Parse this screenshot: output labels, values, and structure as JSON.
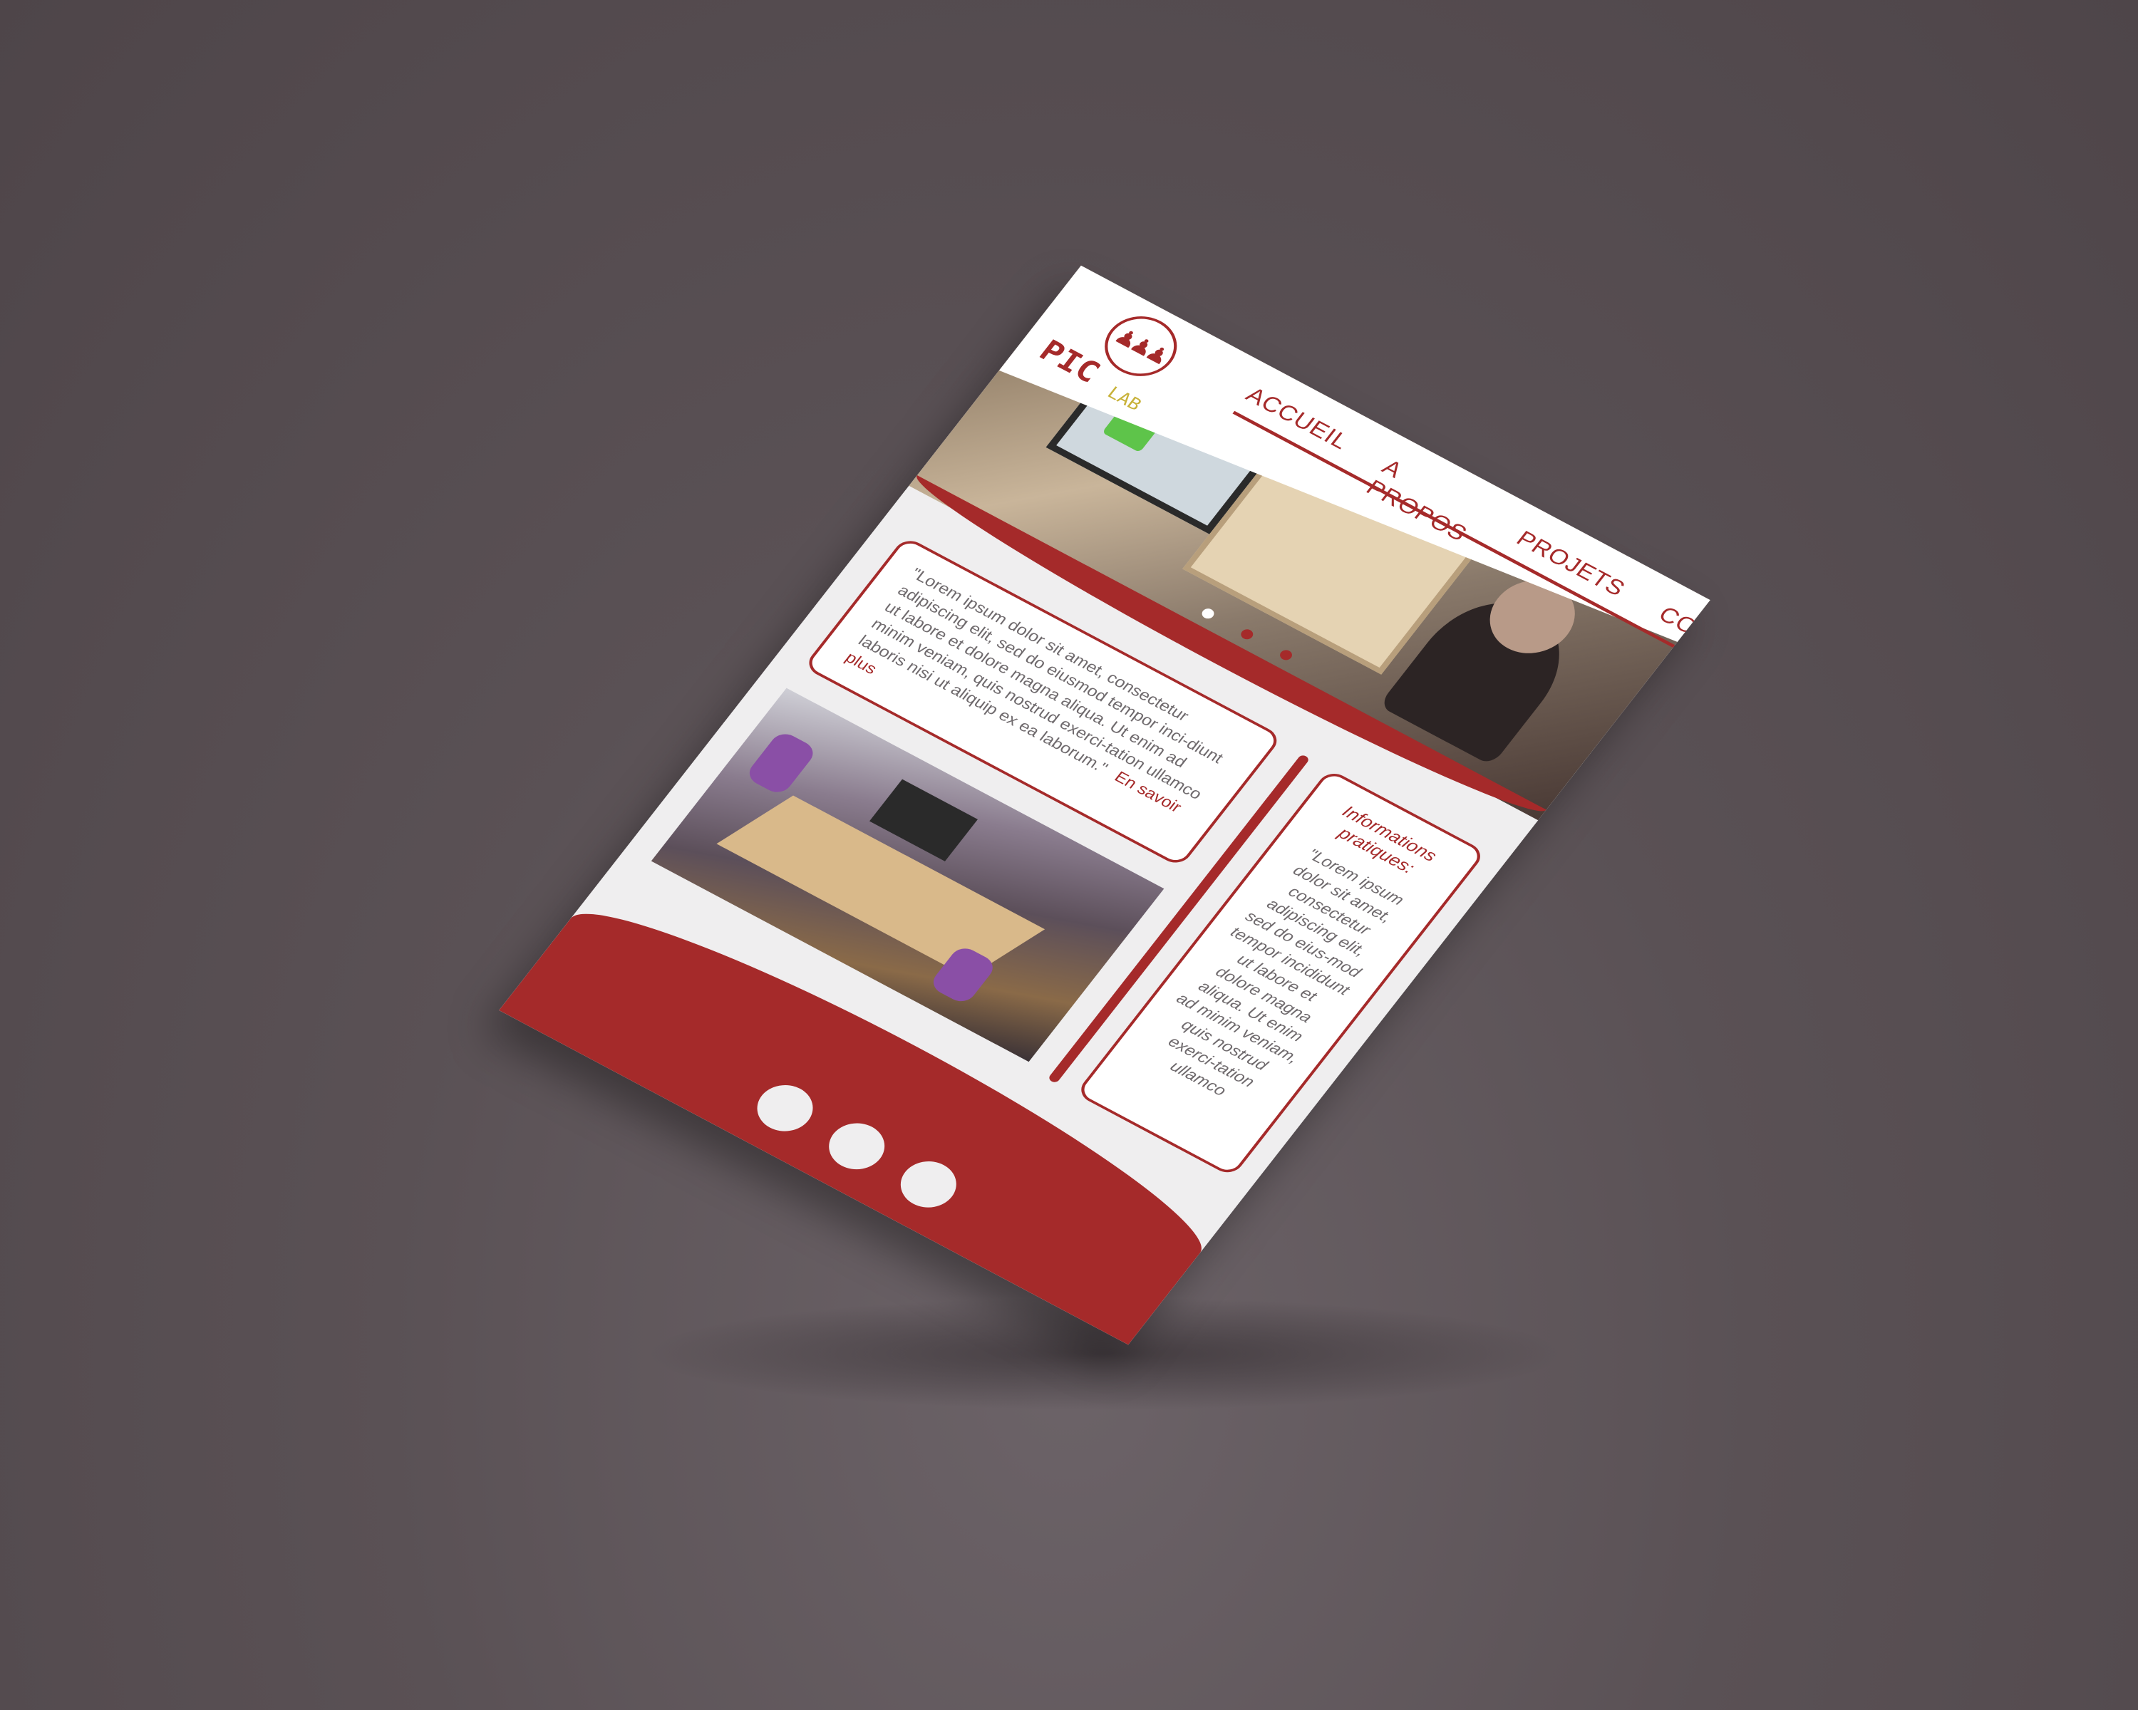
{
  "nav": {
    "items": [
      "ACCUEIL",
      "A PROPOS",
      "PROJETS",
      "CONTACT"
    ]
  },
  "logo": {
    "pic": "PIC",
    "lab": "LAB"
  },
  "quote": {
    "text": "\"Lorem ipsum dolor sit amet, consectetur adipiscing elit, sed do eiusmod tempor inci-diunt ut labore et dolore magna aliqua. Ut enim ad minim veniam, quis nostrud exerci-tation ullamco laboris nisi ut aliquip ex ea laborum.\"",
    "link": "En savoir plus"
  },
  "info": {
    "title": "Informations pratiques:",
    "text": "\"Lorem ipsum dolor sit amet, consectetur adipiscing elit, sed do eius-mod tempor incididunt ut labore et dolore magna aliqua. Ut enim ad minim veniam, quis nostrud exerci-tation ullamco"
  },
  "slider": {
    "count": 3,
    "active_index": 0
  },
  "colors": {
    "accent": "#a52a2a",
    "page_bg": "#efeeef",
    "background": "#564d51",
    "logo_lab": "#c8b23a"
  }
}
